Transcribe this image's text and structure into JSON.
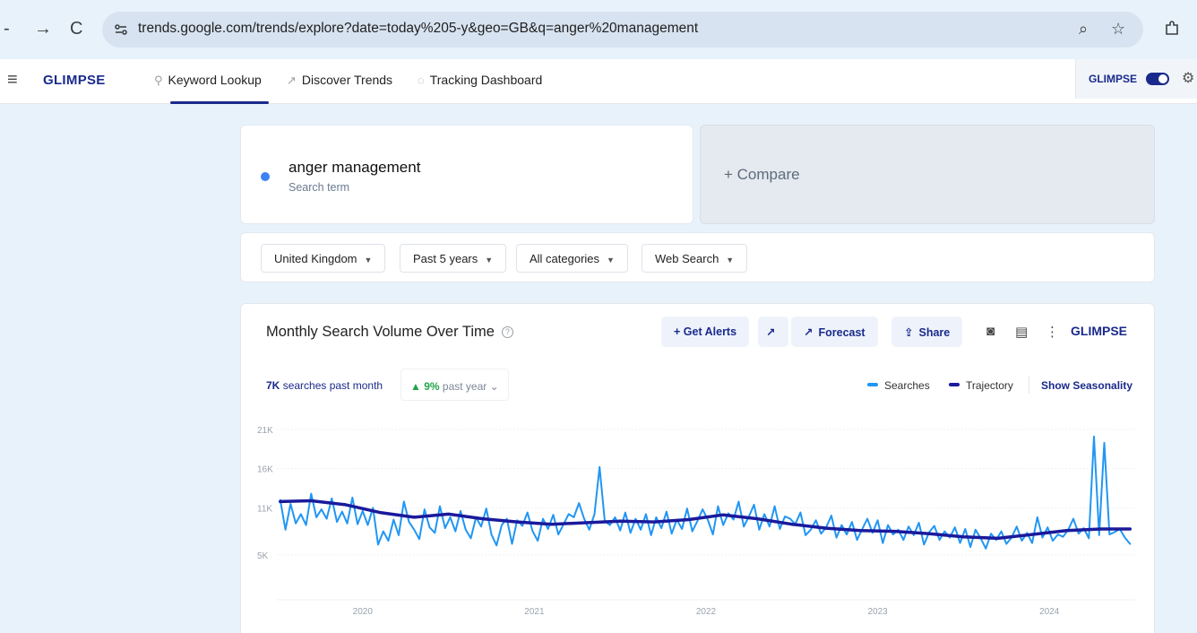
{
  "browser": {
    "url": "trends.google.com/trends/explore?date=today%205-y&geo=GB&q=anger%20management"
  },
  "header": {
    "brand": "GLIMPSE",
    "nav": [
      {
        "label": "Keyword Lookup",
        "icon": "search-icon"
      },
      {
        "label": "Discover Trends",
        "icon": "trend-icon"
      },
      {
        "label": "Tracking Dashboard",
        "icon": "tracking-icon"
      }
    ],
    "extension_brand": "GLIMPSE"
  },
  "search": {
    "term": "anger management",
    "term_sub": "Search term",
    "compare": "+ Compare"
  },
  "filters": [
    "United Kingdom",
    "Past 5 years",
    "All categories",
    "Web Search"
  ],
  "chart_panel": {
    "title": "Monthly Search Volume Over Time",
    "buttons": {
      "alerts": "+ Get Alerts",
      "forecast": "Forecast",
      "share": "Share"
    },
    "logo": "GLIMPSE",
    "stat_month_value": "7K",
    "stat_month_label": "searches past month",
    "stat_year_value": "9%",
    "stat_year_label": "past year",
    "legend_searches": "Searches",
    "legend_trajectory": "Trajectory",
    "show_seasonality": "Show Seasonality"
  },
  "colors": {
    "brand": "#1a2a8c",
    "searches": "#2196f3",
    "trajectory": "#1a1a9c",
    "positive": "#22a447"
  },
  "chart_data": {
    "type": "line",
    "title": "Monthly Search Volume Over Time",
    "ylim": [
      0,
      21000
    ],
    "yticks": [
      {
        "v": 5000,
        "label": "5K"
      },
      {
        "v": 11000,
        "label": "11K"
      },
      {
        "v": 16000,
        "label": "16K"
      },
      {
        "v": 21000,
        "label": "21K"
      }
    ],
    "xticks": [
      {
        "x": 2020.0,
        "label": "2020"
      },
      {
        "x": 2021.0,
        "label": "2021"
      },
      {
        "x": 2022.0,
        "label": "2022"
      },
      {
        "x": 2023.0,
        "label": "2023"
      },
      {
        "x": 2024.0,
        "label": "2024"
      }
    ],
    "xlim": [
      2019.5,
      2024.5
    ],
    "series": [
      {
        "name": "Searches",
        "x": [
          2019.52,
          2019.55,
          2019.58,
          2019.61,
          2019.64,
          2019.67,
          2019.7,
          2019.73,
          2019.76,
          2019.79,
          2019.82,
          2019.85,
          2019.88,
          2019.91,
          2019.94,
          2019.97,
          2020.0,
          2020.03,
          2020.06,
          2020.09,
          2020.12,
          2020.15,
          2020.18,
          2020.21,
          2020.24,
          2020.27,
          2020.3,
          2020.33,
          2020.36,
          2020.39,
          2020.42,
          2020.45,
          2020.48,
          2020.51,
          2020.54,
          2020.57,
          2020.6,
          2020.63,
          2020.66,
          2020.69,
          2020.72,
          2020.75,
          2020.78,
          2020.81,
          2020.84,
          2020.87,
          2020.9,
          2020.93,
          2020.96,
          2020.99,
          2021.02,
          2021.05,
          2021.08,
          2021.11,
          2021.14,
          2021.17,
          2021.2,
          2021.23,
          2021.26,
          2021.29,
          2021.32,
          2021.35,
          2021.38,
          2021.41,
          2021.44,
          2021.47,
          2021.5,
          2021.53,
          2021.56,
          2021.59,
          2021.62,
          2021.65,
          2021.68,
          2021.71,
          2021.74,
          2021.77,
          2021.8,
          2021.83,
          2021.86,
          2021.89,
          2021.92,
          2021.95,
          2021.98,
          2022.01,
          2022.04,
          2022.07,
          2022.1,
          2022.13,
          2022.16,
          2022.19,
          2022.22,
          2022.25,
          2022.28,
          2022.31,
          2022.34,
          2022.37,
          2022.4,
          2022.43,
          2022.46,
          2022.49,
          2022.52,
          2022.55,
          2022.58,
          2022.61,
          2022.64,
          2022.67,
          2022.7,
          2022.73,
          2022.76,
          2022.79,
          2022.82,
          2022.85,
          2022.88,
          2022.91,
          2022.94,
          2022.97,
          2023.0,
          2023.03,
          2023.06,
          2023.09,
          2023.12,
          2023.15,
          2023.18,
          2023.21,
          2023.24,
          2023.27,
          2023.3,
          2023.33,
          2023.36,
          2023.39,
          2023.42,
          2023.45,
          2023.48,
          2023.51,
          2023.54,
          2023.57,
          2023.6,
          2023.63,
          2023.66,
          2023.69,
          2023.72,
          2023.75,
          2023.78,
          2023.81,
          2023.84,
          2023.87,
          2023.9,
          2023.93,
          2023.96,
          2023.99,
          2024.02,
          2024.05,
          2024.08,
          2024.11,
          2024.14,
          2024.17,
          2024.2,
          2024.23,
          2024.26,
          2024.29,
          2024.32,
          2024.35,
          2024.38,
          2024.41,
          2024.44,
          2024.47
        ],
        "values": [
          12000,
          8200,
          11500,
          9000,
          10200,
          8800,
          12800,
          9800,
          10800,
          9600,
          12200,
          9200,
          10500,
          9000,
          12300,
          8900,
          10600,
          8800,
          11000,
          6300,
          8000,
          6800,
          9500,
          7500,
          11800,
          9200,
          8200,
          7000,
          10800,
          8500,
          7800,
          11200,
          8400,
          9800,
          8000,
          10600,
          8200,
          7100,
          9800,
          8600,
          10900,
          7600,
          6200,
          8800,
          9600,
          6400,
          9400,
          8700,
          10400,
          8000,
          6800,
          9600,
          8300,
          10100,
          7600,
          8900,
          10200,
          9800,
          11600,
          9600,
          8200,
          10200,
          16200,
          9300,
          8800,
          9800,
          8100,
          10400,
          7800,
          9600,
          8200,
          10200,
          7500,
          9800,
          8400,
          10500,
          7700,
          9500,
          8300,
          10900,
          8000,
          9300,
          10800,
          9500,
          7600,
          11200,
          8800,
          10300,
          9500,
          11800,
          8600,
          9900,
          11400,
          8200,
          10200,
          8600,
          11200,
          8300,
          9900,
          9600,
          8900,
          10400,
          7500,
          8200,
          9400,
          7700,
          8500,
          10000,
          7200,
          8800,
          7600,
          9200,
          6900,
          8300,
          9600,
          7800,
          9400,
          6500,
          8800,
          7600,
          8200,
          6900,
          8600,
          7500,
          9100,
          6300,
          7900,
          8700,
          6900,
          8000,
          7200,
          8500,
          6500,
          8300,
          6000,
          8200,
          7100,
          5800,
          7700,
          6900,
          8000,
          6400,
          7200,
          8600,
          6800,
          7800,
          6500,
          9800,
          7200,
          8500,
          6800,
          7600,
          7300,
          8200,
          9600,
          7700,
          8400,
          7100,
          20100,
          7500,
          19300,
          7600,
          7900,
          8300,
          7200,
          6400
        ],
        "color": "#2196f3"
      },
      {
        "name": "Trajectory",
        "x": [
          2019.52,
          2019.7,
          2019.9,
          2020.1,
          2020.3,
          2020.5,
          2020.7,
          2020.9,
          2021.1,
          2021.3,
          2021.5,
          2021.7,
          2021.9,
          2022.1,
          2022.3,
          2022.5,
          2022.7,
          2022.9,
          2023.1,
          2023.3,
          2023.5,
          2023.7,
          2023.9,
          2024.1,
          2024.3,
          2024.47
        ],
        "values": [
          11800,
          11900,
          11400,
          10400,
          9800,
          10200,
          9600,
          9200,
          8900,
          9100,
          9300,
          9200,
          9500,
          10100,
          9600,
          8900,
          8400,
          8100,
          8000,
          7700,
          7300,
          7100,
          7600,
          8100,
          8300,
          8300
        ],
        "color": "#1a1a9c"
      }
    ]
  }
}
